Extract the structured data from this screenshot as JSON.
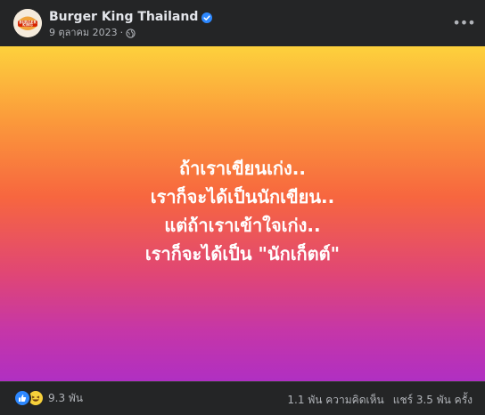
{
  "post": {
    "page_name": "Burger King Thailand",
    "date": "9 ตุลาคม 2023",
    "separator": "·",
    "avatar_text_top": "BURGER",
    "avatar_text_bottom": "KING",
    "media_lines": [
      "ถ้าเราเขียนเก่ง..",
      "เราก็จะได้เป็นนักเขียน..",
      "แต่ถ้าเราเข้าใจเก่ง..",
      "เราก็จะได้เป็น \"นักเก็ตต์\""
    ]
  },
  "footer": {
    "reaction_count": "9.3 พัน",
    "comments": "1.1 พัน ความคิดเห็น",
    "shares": "แชร์ 3.5 พัน ครั้ง"
  },
  "colors": {
    "background": "#242526",
    "verified": "#2d88ff",
    "gradient_top": "#fdd13c",
    "gradient_bottom": "#b02fc2"
  },
  "icons": {
    "verified": "verified-badge-icon",
    "privacy": "globe-icon",
    "more": "more-options-icon",
    "like": "like-reaction-icon",
    "haha": "haha-reaction-icon"
  }
}
